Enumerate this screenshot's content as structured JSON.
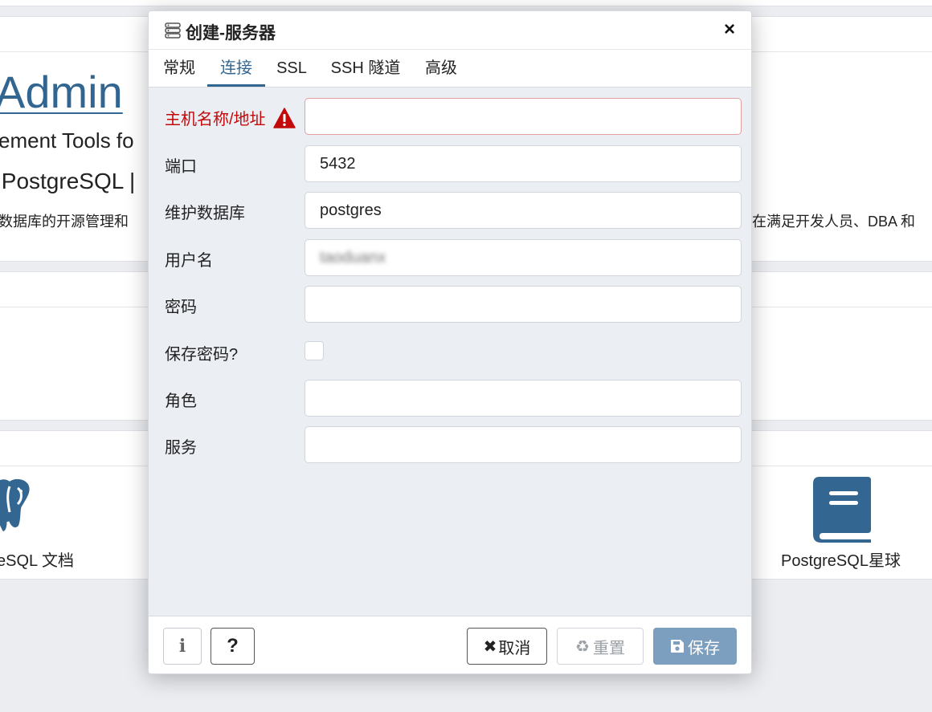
{
  "background": {
    "brand_partial": "Admin",
    "tagline_partial": "ement Tools fo",
    "pg_line_partial": "]PostgreSQL |",
    "desc_left": "数据库的开源管理和",
    "desc_right": "在满足开发人员、DBA 和",
    "link_docs": "eSQL 文档",
    "link_planet": "PostgreSQL星球"
  },
  "dialog": {
    "title": "创建-服务器",
    "close_label": "×",
    "tabs": [
      {
        "label": "常规"
      },
      {
        "label": "连接"
      },
      {
        "label": "SSL"
      },
      {
        "label": "SSH 隧道"
      },
      {
        "label": "高级"
      }
    ],
    "active_tab": "连接",
    "fields": {
      "host": {
        "label": "主机名称/地址",
        "value": "",
        "status": "error"
      },
      "port": {
        "label": "端口",
        "value": "5432"
      },
      "maintenance_db": {
        "label": "维护数据库",
        "value": "postgres"
      },
      "username": {
        "label": "用户名",
        "value": "taoduanx"
      },
      "password": {
        "label": "密码",
        "value": ""
      },
      "save_password": {
        "label": "保存密码?",
        "checked": false
      },
      "role": {
        "label": "角色",
        "value": ""
      },
      "service": {
        "label": "服务",
        "value": ""
      }
    },
    "footer": {
      "info_label": "i",
      "help_label": "?",
      "cancel_label": "取消",
      "reset_label": "重置",
      "save_label": "保存"
    }
  },
  "colors": {
    "accent": "#326690",
    "error": "#c20a0a",
    "save_button": "#7d9fbf"
  }
}
